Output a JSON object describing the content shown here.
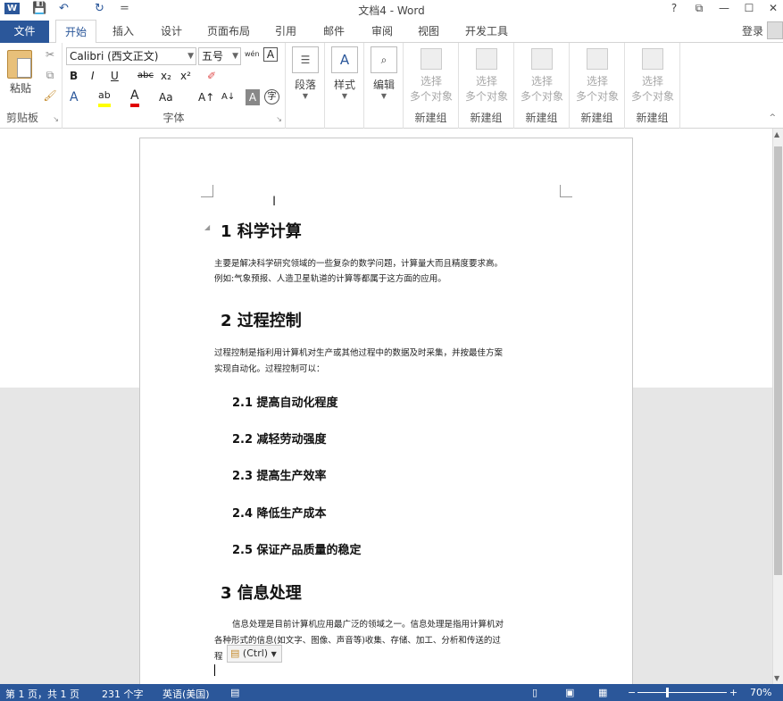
{
  "window": {
    "title": "文档4 - Word",
    "help": "?",
    "restore": "⧉",
    "min": "—",
    "max": "☐",
    "close": "✕"
  },
  "quick_access": {
    "word_icon": "W",
    "save": "💾",
    "undo": "↶",
    "redo": "↻",
    "customize": "="
  },
  "tabs": {
    "file": "文件",
    "items": [
      "开始",
      "插入",
      "设计",
      "页面布局",
      "引用",
      "邮件",
      "审阅",
      "视图",
      "开发工具"
    ],
    "active": "开始",
    "login": "登录"
  },
  "ribbon": {
    "clipboard": {
      "paste": "粘贴",
      "group": "剪贴板"
    },
    "font": {
      "font_name": "Calibri (西文正文)",
      "font_size": "五号",
      "wen": "wén",
      "A_box": "A",
      "B": "B",
      "I": "I",
      "U": "U",
      "abc": "abc",
      "sub": "x₂",
      "sup": "x²",
      "eraser": "✐",
      "A_effects": "A",
      "ab": "ab",
      "A_color": "A",
      "Aa": "Aa",
      "A_grow": "A↑",
      "A_shrink": "A↓",
      "A_shade": "A",
      "zi": "字",
      "group": "字体"
    },
    "paragraph": {
      "label": "段落"
    },
    "styles": {
      "label": "样式"
    },
    "editing": {
      "label": "编辑"
    },
    "new_groups": [
      {
        "line1": "选择",
        "line2": "多个对象",
        "group": "新建组"
      },
      {
        "line1": "选择",
        "line2": "多个对象",
        "group": "新建组"
      },
      {
        "line1": "选择",
        "line2": "多个对象",
        "group": "新建组"
      },
      {
        "line1": "选择",
        "line2": "多个对象",
        "group": "新建组"
      },
      {
        "line1": "选择",
        "line2": "多个对象",
        "group": "新建组"
      }
    ]
  },
  "document": {
    "h1": "1 科学计算",
    "p1a": "主要是解决科学研究领域的一些复杂的数学问题，计算量大而且精度要求高。",
    "p1b": "例如:气象预报、人造卫星轨道的计算等都属于这方面的应用。",
    "h2": "2 过程控制",
    "p2a": "过程控制是指利用计算机对生产或其他过程中的数据及时采集，并按最佳方案",
    "p2b": "实现自动化。过程控制可以：",
    "sub": [
      "2.1 提高自动化程度",
      "2.2 减轻劳动强度",
      "2.3 提高生产效率",
      "2.4 降低生产成本",
      "2.5 保证产品质量的稳定"
    ],
    "h3": "3 信息处理",
    "p3a": "信息处理是目前计算机应用最广泛的领域之一。信息处理是指用计算机对",
    "p3b": "各种形式的信息(如文字、图像、声音等)收集、存储、加工、分析和传送的过",
    "p3c": "程",
    "paste_options": "(Ctrl)"
  },
  "status": {
    "page": "第 1 页，共 1 页",
    "words": "231 个字",
    "lang": "英语(美国)",
    "zoom": "70%",
    "zoom_minus": "−",
    "zoom_plus": "+"
  }
}
